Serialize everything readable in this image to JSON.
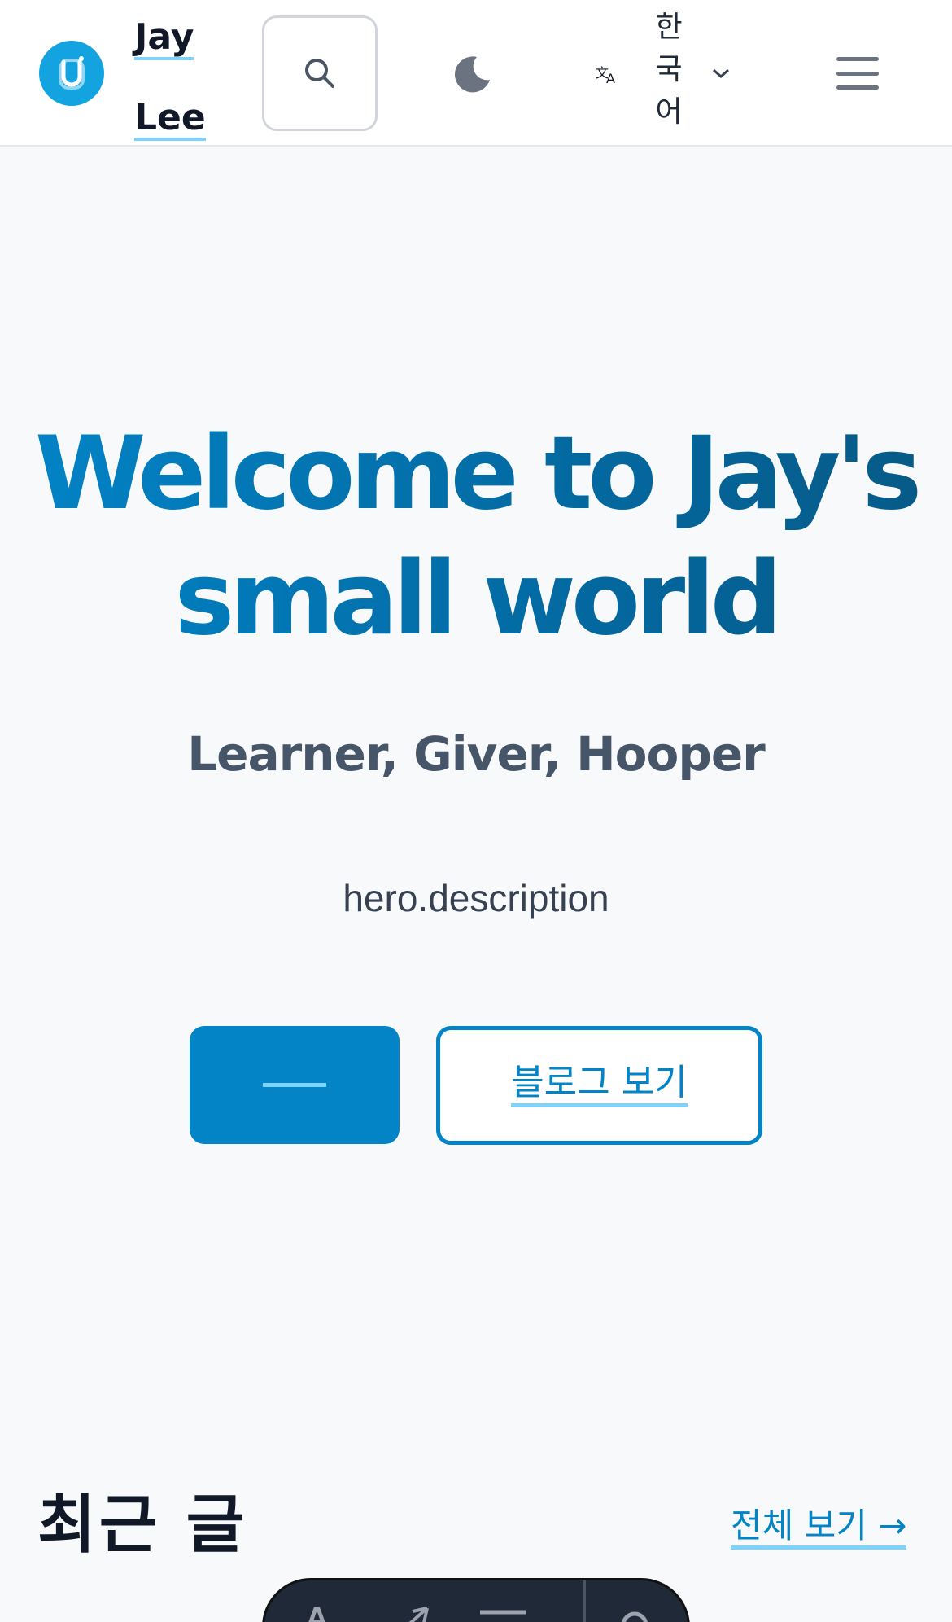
{
  "header": {
    "title_line1": "Jay",
    "title_line2": "Lee",
    "logo_icon": "smiley-u-logo-icon",
    "search_icon": "search-icon",
    "theme_icon": "moon-icon",
    "language_icon": "translate-icon",
    "language_label": "한국어",
    "language_chevron_icon": "chevron-down-icon",
    "menu_icon": "hamburger-menu-icon"
  },
  "hero": {
    "title": "Welcome to Jay's small world",
    "subtitle": "Learner, Giver, Hooper",
    "description": "hero.description",
    "primary_button_label": "",
    "secondary_button_label": "블로그 보기"
  },
  "recent": {
    "title": "최근 글",
    "view_all": "전체 보기 →"
  },
  "colors": {
    "accent": "#0284c7",
    "accent_light": "#7dd3fc",
    "logo": "#13a3e0",
    "background": "#f8f9fa"
  }
}
